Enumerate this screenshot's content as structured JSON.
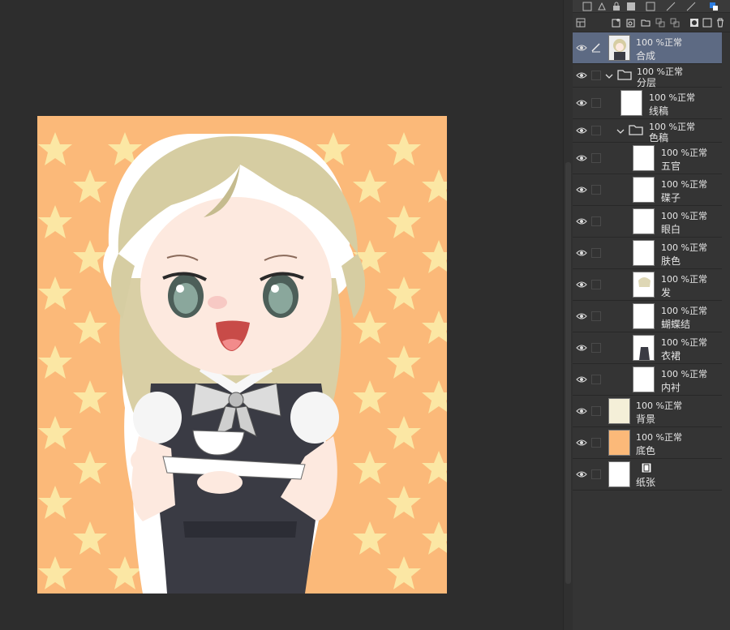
{
  "colors": {
    "canvas_bg": "#fbb979",
    "selected_layer": "#5d6a83",
    "base_color_swatch": "#fbb979"
  },
  "layers": [
    {
      "id": "composite",
      "opacity": "100 %正常",
      "name": "合成",
      "selected": true,
      "icon": "pen-icon"
    },
    {
      "id": "folder-layers",
      "opacity": "100 %正常",
      "name": "分层",
      "type": "folder"
    },
    {
      "id": "lineart",
      "opacity": "100 %正常",
      "name": "线稿"
    },
    {
      "id": "folder-color",
      "opacity": "100 %正常",
      "name": "色稿",
      "type": "folder"
    },
    {
      "id": "features",
      "opacity": "100 %正常",
      "name": "五官"
    },
    {
      "id": "saucer",
      "opacity": "100 %正常",
      "name": "碟子"
    },
    {
      "id": "eye-white",
      "opacity": "100 %正常",
      "name": "眼白"
    },
    {
      "id": "skin",
      "opacity": "100 %正常",
      "name": "肤色"
    },
    {
      "id": "hair",
      "opacity": "100 %正常",
      "name": "发"
    },
    {
      "id": "bow",
      "opacity": "100 %正常",
      "name": "蝴蝶结"
    },
    {
      "id": "dress",
      "opacity": "100 %正常",
      "name": "衣裙"
    },
    {
      "id": "inner-shirt",
      "opacity": "100 %正常",
      "name": "内衬"
    },
    {
      "id": "background",
      "opacity": "100 %正常",
      "name": "背景"
    },
    {
      "id": "base-color",
      "opacity": "100 %正常",
      "name": "底色"
    },
    {
      "id": "paper",
      "opacity": "",
      "name": "纸张",
      "icon": "paper-icon"
    }
  ]
}
